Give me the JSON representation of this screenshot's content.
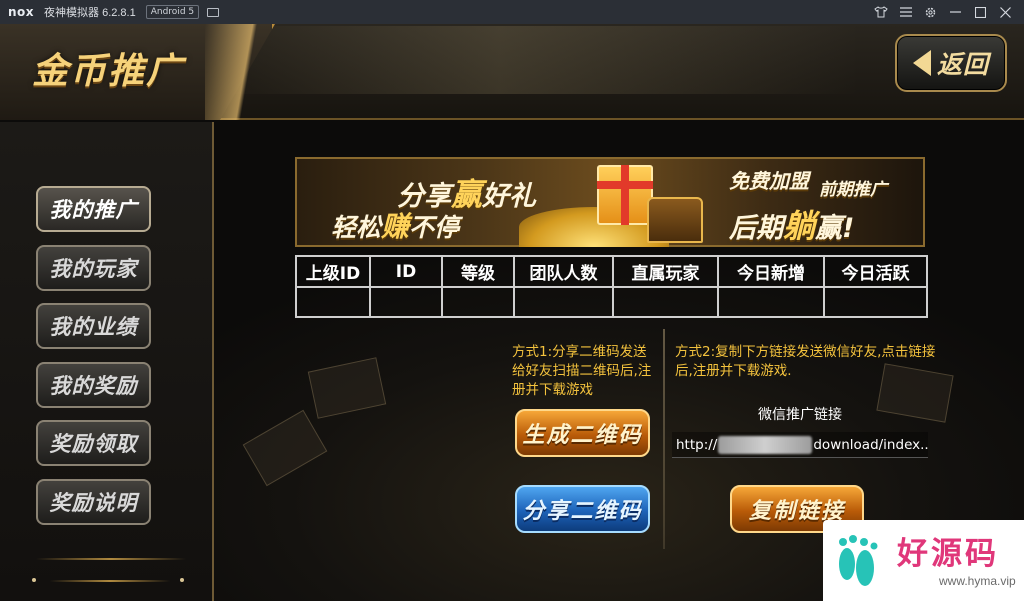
{
  "emulator": {
    "logo": "nox",
    "name": "夜神模拟器 6.2.8.1",
    "android_badge": "Android 5",
    "controls": [
      "shirt-icon",
      "menu-icon",
      "gear-icon",
      "minimize-icon",
      "maximize-icon",
      "close-icon"
    ]
  },
  "header": {
    "title": "金币推广",
    "back_label": "返回"
  },
  "sidebar": {
    "items": [
      {
        "label": "我的推广",
        "active": true
      },
      {
        "label": "我的玩家",
        "active": false
      },
      {
        "label": "我的业绩",
        "active": false
      },
      {
        "label": "我的奖励",
        "active": false
      },
      {
        "label": "奖励领取",
        "active": false
      },
      {
        "label": "奖励说明",
        "active": false
      }
    ]
  },
  "banner": {
    "line1_a": "分享",
    "line1_b": "赢",
    "line1_c": "好礼",
    "line2_a": "轻松",
    "line2_b": "赚",
    "line2_c": "不停",
    "right1": "免费加盟",
    "right2": "前期推广",
    "right3_a": "后期",
    "right3_b": "躺",
    "right3_c": "赢!"
  },
  "table": {
    "headers": [
      "上级ID",
      "ID",
      "等级",
      "团队人数",
      "直属玩家",
      "今日新增",
      "今日活跃"
    ],
    "row": [
      "",
      "",
      "",
      "",
      "",
      "",
      ""
    ]
  },
  "promo": {
    "method1": "方式1:分享二维码发送给好友扫描二维码后,注册并下载游戏",
    "method2": "方式2:复制下方链接发送微信好友,点击链接后,注册并下载游戏.",
    "link_label": "微信推广链接",
    "link_prefix": "http://",
    "link_suffix": "download/index..",
    "generate_qr": "生成二维码",
    "share_qr": "分享二维码",
    "copy_link": "复制链接"
  },
  "watermark": {
    "title": "好源码",
    "url": "www.hyma.vip"
  },
  "colors": {
    "accent_gold": "#f3c23d",
    "title_gold": "#f6d27a",
    "orange_button": "#b95b08",
    "blue_button": "#1d62b8",
    "watermark_pink": "#e0377a"
  }
}
